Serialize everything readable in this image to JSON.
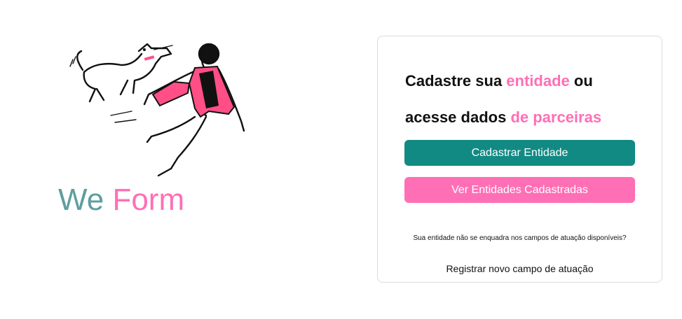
{
  "brand": {
    "part1": "We",
    "part2": "Form"
  },
  "icons": {
    "illustration": "person-running-with-dog-illustration"
  },
  "card": {
    "title_line1_prefix": "Cadastre sua ",
    "title_line1_accent": "entidade",
    "title_line1_suffix": " ou",
    "title_line2_prefix": "acesse dados ",
    "title_line2_accent": "de parceiras",
    "register_button": "Cadastrar Entidade",
    "view_button": "Ver Entidades Cadastradas",
    "hint": "Sua entidade não se enquadra nos campos de atuação disponíveis?",
    "new_field_link": "Registrar novo campo de atuação"
  },
  "colors": {
    "teal": "#128a84",
    "pink": "#ff6fb5",
    "brand_teal": "#5f9ea0"
  }
}
